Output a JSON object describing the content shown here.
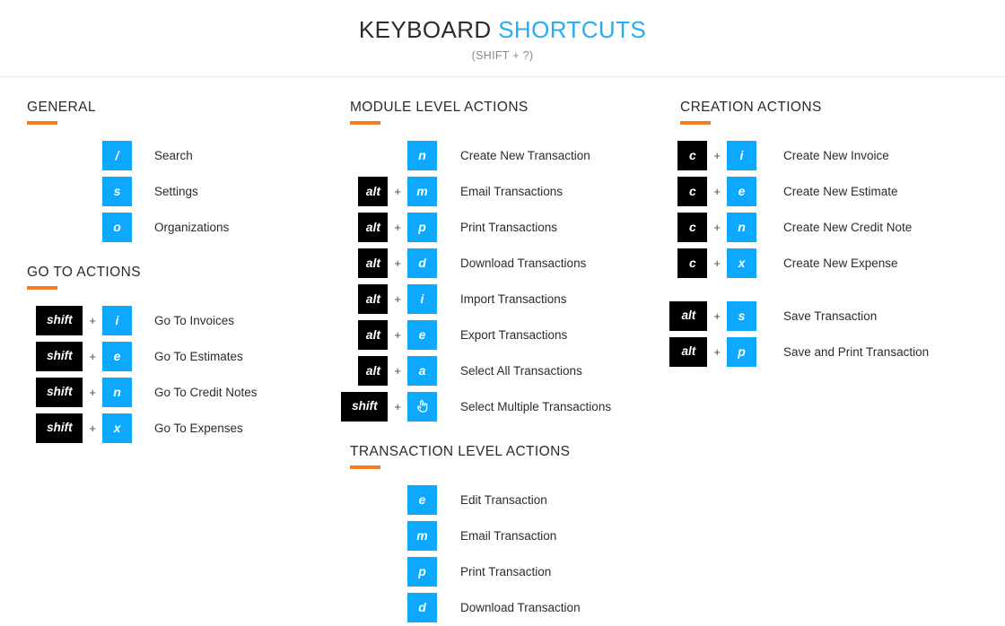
{
  "header": {
    "title_main": "KEYBOARD",
    "title_accent": "SHORTCUTS",
    "subtitle": "(SHIFT + ?)"
  },
  "colors": {
    "key_blue": "#0DA9FF",
    "key_black": "#000000",
    "accent_rule": "#F47B20",
    "title_accent": "#23ADF5"
  },
  "columns": {
    "left": {
      "sections": [
        {
          "heading": "GENERAL",
          "rows": [
            {
              "mod": "",
              "key": "/",
              "label": "Search"
            },
            {
              "mod": "",
              "key": "s",
              "label": "Settings"
            },
            {
              "mod": "",
              "key": "o",
              "label": "Organizations"
            }
          ]
        },
        {
          "heading": "GO TO ACTIONS",
          "rows": [
            {
              "mod": "shift",
              "key": "i",
              "label": "Go To Invoices"
            },
            {
              "mod": "shift",
              "key": "e",
              "label": "Go To Estimates"
            },
            {
              "mod": "shift",
              "key": "n",
              "label": "Go To Credit Notes"
            },
            {
              "mod": "shift",
              "key": "x",
              "label": "Go To Expenses"
            }
          ]
        }
      ]
    },
    "middle": {
      "sections": [
        {
          "heading": "MODULE LEVEL ACTIONS",
          "rows": [
            {
              "mod": "",
              "key": "n",
              "label": "Create New Transaction"
            },
            {
              "mod": "alt",
              "key": "m",
              "label": "Email Transactions"
            },
            {
              "mod": "alt",
              "key": "p",
              "label": "Print Transactions"
            },
            {
              "mod": "alt",
              "key": "d",
              "label": "Download Transactions"
            },
            {
              "mod": "alt",
              "key": "i",
              "label": "Import Transactions"
            },
            {
              "mod": "alt",
              "key": "e",
              "label": "Export Transactions"
            },
            {
              "mod": "alt",
              "key": "a",
              "label": "Select All Transactions"
            },
            {
              "mod": "shift",
              "key": "click-hand-icon",
              "label": "Select Multiple Transactions"
            }
          ]
        },
        {
          "heading": "TRANSACTION LEVEL ACTIONS",
          "rows": [
            {
              "mod": "",
              "key": "e",
              "label": "Edit Transaction"
            },
            {
              "mod": "",
              "key": "m",
              "label": "Email Transaction"
            },
            {
              "mod": "",
              "key": "p",
              "label": "Print Transaction"
            },
            {
              "mod": "",
              "key": "d",
              "label": "Download Transaction"
            }
          ]
        }
      ]
    },
    "right": {
      "sections": [
        {
          "heading": "CREATION ACTIONS",
          "rows": [
            {
              "mod": "c",
              "key": "i",
              "label": "Create New Invoice"
            },
            {
              "mod": "c",
              "key": "e",
              "label": "Create New Estimate"
            },
            {
              "mod": "c",
              "key": "n",
              "label": "Create New Credit Note"
            },
            {
              "mod": "c",
              "key": "x",
              "label": "Create New Expense"
            },
            {
              "mod": "alt",
              "key": "s",
              "label": "Save Transaction",
              "spacer_before": true
            },
            {
              "mod": "alt",
              "key": "p",
              "label": "Save and Print Transaction"
            }
          ]
        }
      ]
    }
  },
  "plus_symbol": "+"
}
